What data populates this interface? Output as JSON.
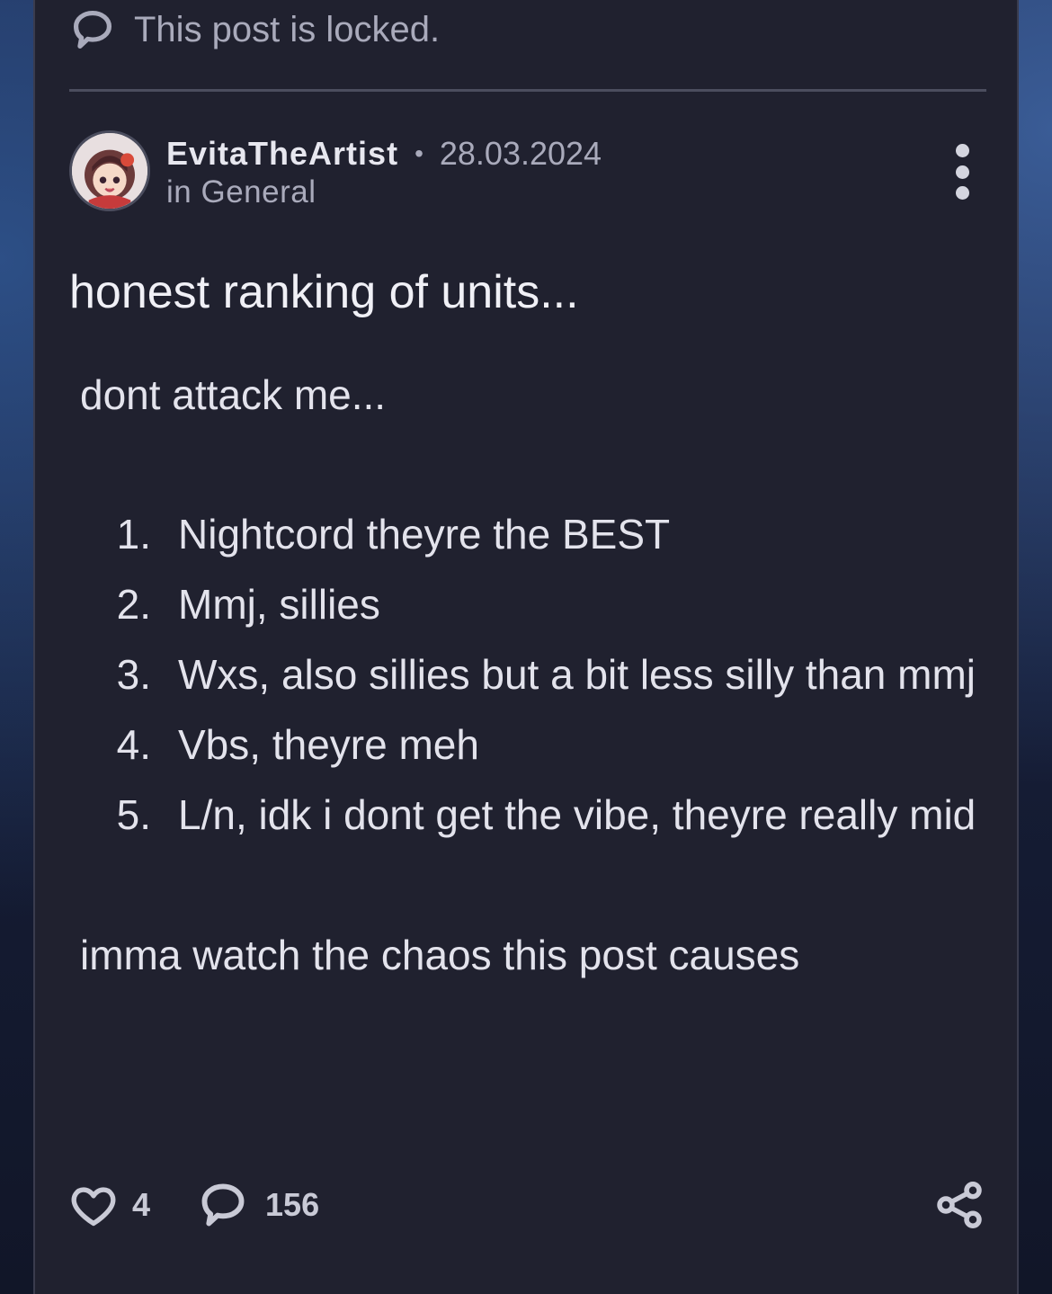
{
  "banner": {
    "locked_text": "This post is locked."
  },
  "post": {
    "author": "EvitaTheArtist",
    "separator": "•",
    "date": "28.03.2024",
    "category": "in General",
    "title": "honest ranking of units...",
    "intro": "dont attack me...",
    "ranking": [
      {
        "num": "1.",
        "text": "Nightcord theyre the BEST"
      },
      {
        "num": "2.",
        "text": "Mmj, sillies"
      },
      {
        "num": "3.",
        "text": "Wxs, also sillies but a bit less silly than mmj"
      },
      {
        "num": "4.",
        "text": "Vbs, theyre meh"
      },
      {
        "num": "5.",
        "text": "L/n, idk i dont get the vibe, theyre really mid"
      }
    ],
    "outro": "imma watch the chaos this post causes"
  },
  "actions": {
    "likes": "4",
    "comments": "156"
  },
  "colors": {
    "card": "#20212f",
    "text_muted": "#a9aabb",
    "text_main": "#e3e3ec"
  },
  "icons": {
    "locked": "speech-bubble-icon",
    "like": "heart-icon",
    "comment": "comment-icon",
    "share": "share-icon",
    "menu": "more-vertical-icon"
  }
}
